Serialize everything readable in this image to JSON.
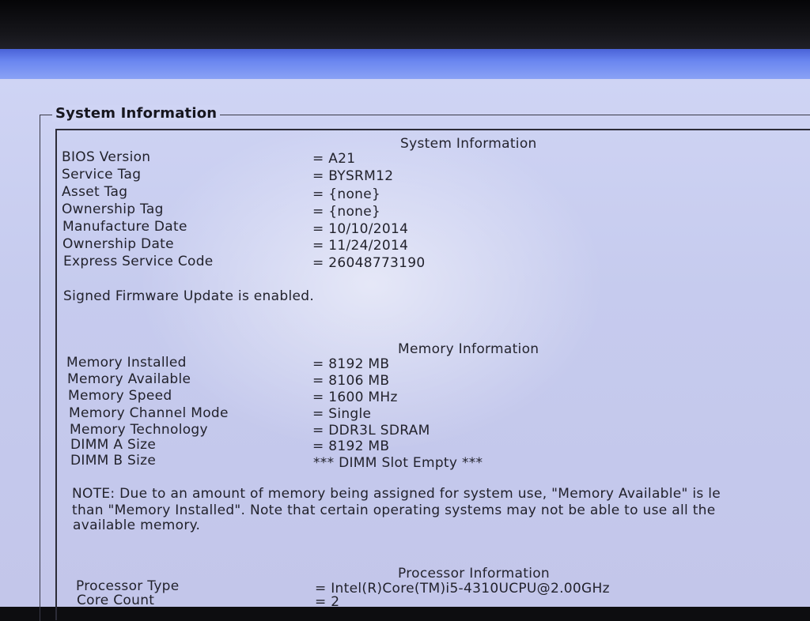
{
  "group_title": "System Information",
  "system": {
    "heading": "System Information",
    "rows": [
      {
        "label": "BIOS Version",
        "value": "= A21"
      },
      {
        "label": "Service Tag",
        "value": "= BYSRM12"
      },
      {
        "label": "Asset Tag",
        "value": "= {none}"
      },
      {
        "label": "Ownership Tag",
        "value": "= {none}"
      },
      {
        "label": "Manufacture Date",
        "value": "= 10/10/2014"
      },
      {
        "label": "Ownership Date",
        "value": "= 11/24/2014"
      },
      {
        "label": "Express Service Code",
        "value": "= 26048773190"
      }
    ],
    "firmware_note": "Signed Firmware Update is enabled."
  },
  "memory": {
    "heading": "Memory Information",
    "rows": [
      {
        "label": "Memory Installed",
        "value": "= 8192 MB"
      },
      {
        "label": "Memory Available",
        "value": "= 8106 MB"
      },
      {
        "label": "Memory Speed",
        "value": "= 1600 MHz"
      },
      {
        "label": "Memory Channel Mode",
        "value": "= Single"
      },
      {
        "label": "Memory Technology",
        "value": "= DDR3L SDRAM"
      },
      {
        "label": "DIMM A Size",
        "value": "= 8192 MB"
      },
      {
        "label": "DIMM B Size",
        "value": "*** DIMM Slot Empty ***"
      }
    ],
    "note_lines": [
      "NOTE: Due to an amount of memory being assigned for system use, \"Memory Available\" is le",
      "than \"Memory Installed\". Note that certain operating systems may not be able to use all the",
      "available memory."
    ]
  },
  "processor": {
    "heading": "Processor Information",
    "rows": [
      {
        "label": "Processor Type",
        "value": "= Intel(R)Core(TM)i5-4310UCPU@2.00GHz"
      },
      {
        "label": "Core Count",
        "value": "= 2"
      }
    ]
  }
}
